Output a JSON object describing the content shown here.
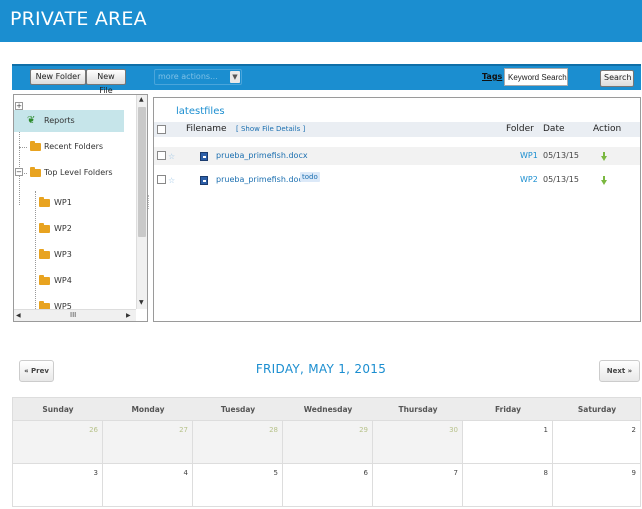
{
  "header": {
    "title": "PRIVATE AREA"
  },
  "toolbar": {
    "new_folder": "New Folder",
    "new_file": "New File",
    "more_actions_placeholder": "more actions...",
    "tags_link": "Tags",
    "search_value": "Keyword Search",
    "search_button": "Search"
  },
  "tree": {
    "items": [
      {
        "label": "Reports",
        "selected": true
      },
      {
        "label": "Recent Folders"
      },
      {
        "label": "Top Level Folders"
      },
      {
        "label": "WP1"
      },
      {
        "label": "WP2"
      },
      {
        "label": "WP3"
      },
      {
        "label": "WP4"
      },
      {
        "label": "WP5"
      }
    ],
    "hscroll_grip": "III"
  },
  "files": {
    "title": "latestfiles",
    "col_filename": "Filename",
    "show_details": "Show File Details",
    "col_folder": "Folder",
    "col_date": "Date",
    "col_action": "Action",
    "rows": [
      {
        "name": "prueba_primefish.docx",
        "tag": "",
        "folder": "WP1",
        "date": "05/13/15"
      },
      {
        "name": "prueba_primefish.docx",
        "tag": "todo",
        "folder": "WP2",
        "date": "05/13/15"
      }
    ]
  },
  "calendar": {
    "prev": "« Prev",
    "next": "Next »",
    "title": "FRIDAY, MAY 1, 2015",
    "days": [
      "Sunday",
      "Monday",
      "Tuesday",
      "Wednesday",
      "Thursday",
      "Friday",
      "Saturday"
    ],
    "week1": [
      "26",
      "27",
      "28",
      "29",
      "30",
      "1",
      "2"
    ],
    "week2": [
      "3",
      "4",
      "5",
      "6",
      "7",
      "8",
      "9"
    ]
  },
  "colors": {
    "accent": "#1b8ed0",
    "selected": "#c6e5ea",
    "other_month_text": "#b7c28a"
  }
}
